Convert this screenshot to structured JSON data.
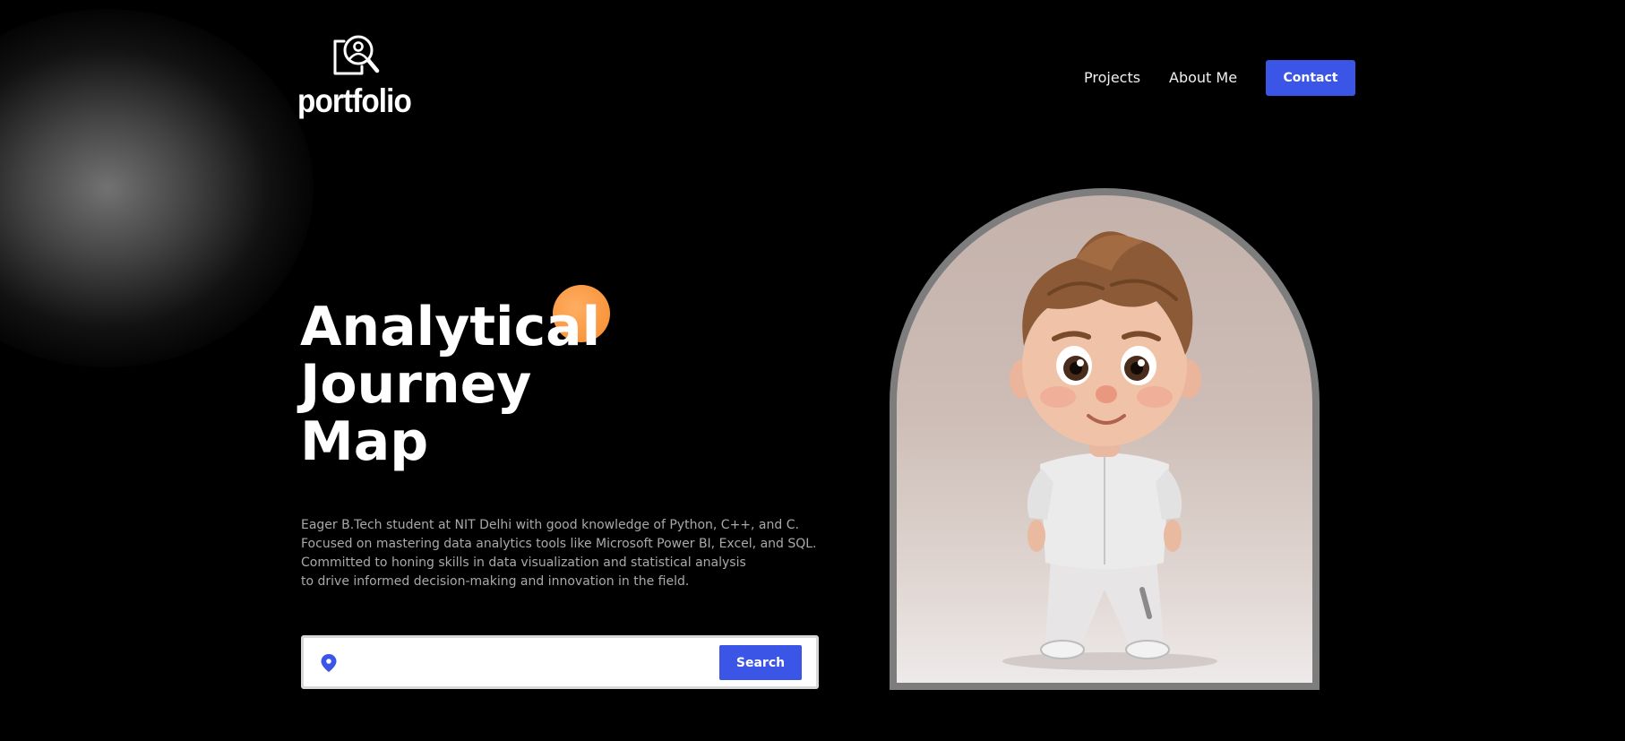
{
  "header": {
    "logo_text": "portfolio",
    "logo_icon": "profile-search-icon",
    "nav": {
      "projects": "Projects",
      "about": "About Me",
      "contact": "Contact"
    }
  },
  "hero": {
    "title_lines": [
      "Analytical",
      "Journey",
      "Map"
    ],
    "description_lines": [
      "Eager B.Tech student at NIT Delhi with good knowledge of Python, C++, and C.",
      "Focused on mastering data analytics tools like Microsoft Power BI, Excel, and SQL.",
      "Committed to honing skills in data visualization and statistical analysis",
      "to drive informed decision-making and innovation in the field."
    ]
  },
  "search": {
    "icon": "location-pin-icon",
    "value": "",
    "placeholder": "",
    "button_label": "Search"
  },
  "colors": {
    "background": "#000000",
    "accent": "#3b55e6",
    "orange": "#f9963d",
    "text_muted": "#a9a9a9",
    "arch_frame": "#7d7d7d"
  }
}
